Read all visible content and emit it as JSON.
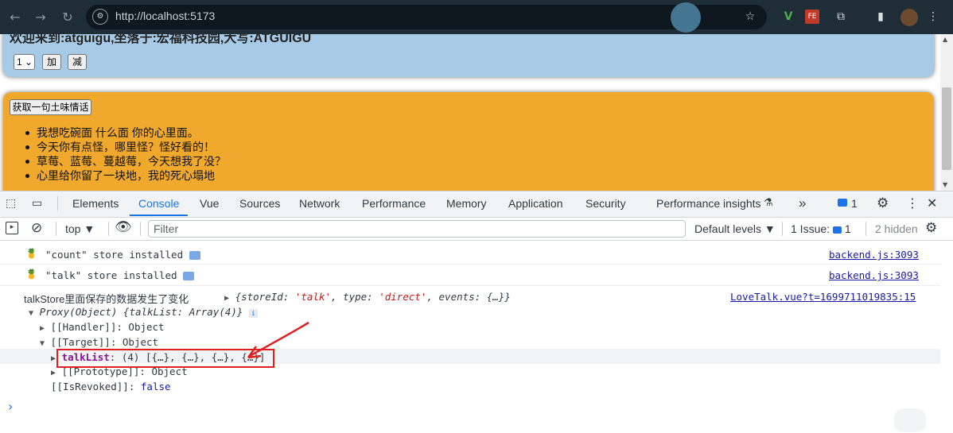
{
  "browser": {
    "url": "http://localhost:5173"
  },
  "page": {
    "count": {
      "title": "欢迎来到:atguigu,坐落于:宏福科技园,大写:ATGUIGU",
      "select_value": "1",
      "add_label": "加",
      "minus_label": "减"
    },
    "talk": {
      "button_label": "获取一句土味情话",
      "items": [
        "我想吃碗面 什么面 你的心里面。",
        "今天你有点怪，哪里怪？怪好看的！",
        "草莓、蓝莓、蔓越莓，今天想我了没？",
        "心里给你留了一块地，我的死心塌地"
      ]
    }
  },
  "devtools": {
    "tabs": [
      "Elements",
      "Console",
      "Vue",
      "Sources",
      "Network",
      "Performance",
      "Memory",
      "Application",
      "Security",
      "Performance insights"
    ],
    "active_tab": "Console",
    "more_tabs": "»",
    "message_count": "1",
    "toolbar": {
      "context": "top",
      "filter_placeholder": "Filter",
      "levels": "Default levels",
      "issues_label": "1 Issue:",
      "issues_count": "1",
      "hidden": "2 hidden"
    },
    "console": {
      "msg1_text": "\"count\" store installed",
      "msg1_source": "backend.js:3093",
      "msg2_text": "\"talk\" store installed",
      "msg2_source": "backend.js:3093",
      "msg3_text": "talkStore里面保存的数据发生了变化",
      "msg3_obj_open": "{",
      "msg3_k1": "storeId",
      "msg3_v1": "'talk'",
      "msg3_k2": "type",
      "msg3_v2": "'direct'",
      "msg3_k3": "events",
      "msg3_v3": "{…}",
      "msg3_obj_close": "}",
      "msg3_source": "LoveTalk.vue?t=1699711019835:15",
      "proxy_line": "Proxy(Object) {talkList: Array(4)}",
      "handler_key": "[[Handler]]",
      "handler_val": "Object",
      "target_key": "[[Target]]",
      "target_val": "Object",
      "talklist_key": "talkList",
      "talklist_val": "(4) [{…}, {…}, {…}, {…}]",
      "prototype_key": "[[Prototype]]",
      "prototype_val": "Object",
      "revoked_key": "[[IsRevoked]]",
      "revoked_val": "false",
      "prompt": "›"
    }
  },
  "colors": {
    "count_bg": "#a7cbe6",
    "talk_bg": "#f0a82d",
    "annotation_red": "#e02020",
    "active_tab": "#1a73e8"
  }
}
